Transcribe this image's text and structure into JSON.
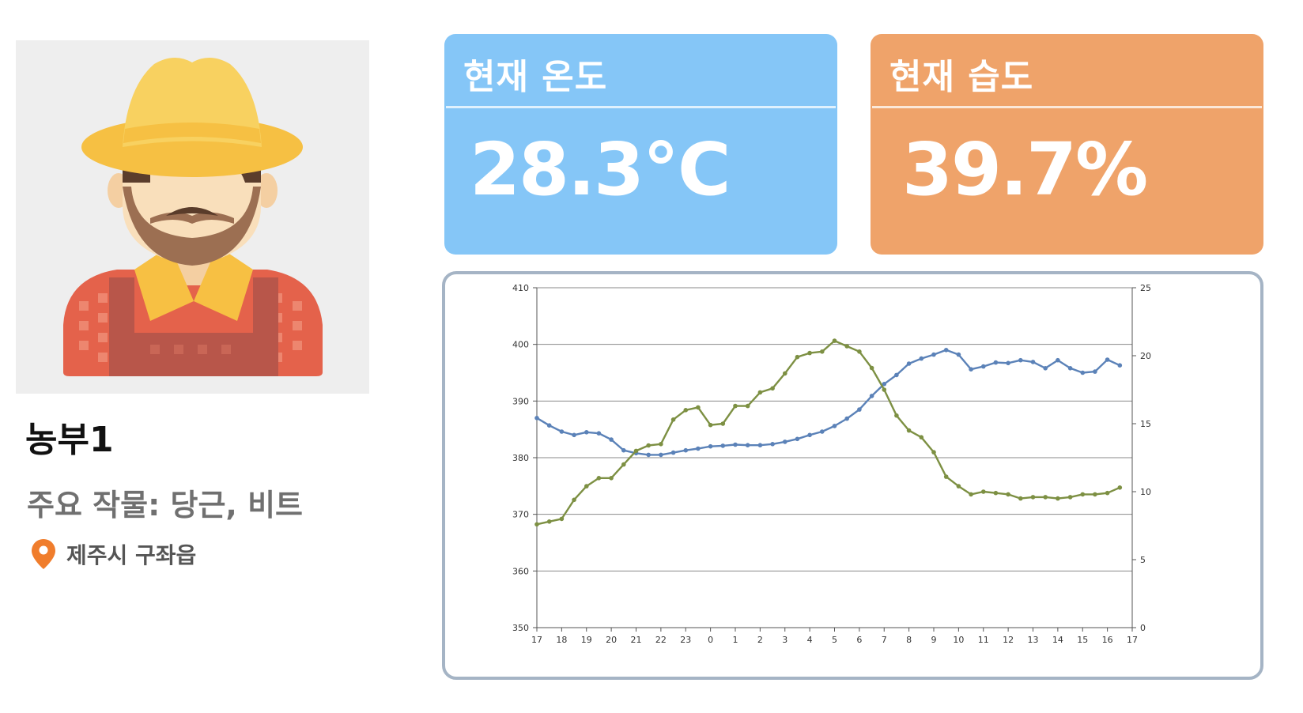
{
  "profile": {
    "name": "농부1",
    "crops": "주요 작물: 당근, 비트",
    "location": "제주시 구좌읍",
    "avatar_icon": "farmer-avatar",
    "location_icon": "map-pin-icon",
    "location_icon_color": "#f07d2c"
  },
  "cards": {
    "temperature": {
      "title": "현재 온도",
      "value": "28.3°C",
      "color": "#85c6f7"
    },
    "humidity": {
      "title": "현재 습도",
      "value": "39.7%",
      "color": "#efa36a"
    }
  },
  "chart_data": {
    "type": "line",
    "x_ticks": [
      "17",
      "18",
      "19",
      "20",
      "21",
      "22",
      "23",
      "0",
      "1",
      "2",
      "3",
      "4",
      "5",
      "6",
      "7",
      "8",
      "9",
      "10",
      "11",
      "12",
      "13",
      "14",
      "15",
      "16",
      "17"
    ],
    "y_left": {
      "ticks": [
        350,
        360,
        370,
        380,
        390,
        400,
        410
      ],
      "ylim": [
        350,
        410
      ]
    },
    "y_right": {
      "ticks": [
        0,
        5,
        10,
        15,
        20,
        25
      ],
      "ylim": [
        0,
        25
      ]
    },
    "grid": "horizontal",
    "series": [
      {
        "axis": "left",
        "color": "#5b82b8",
        "x": [
          0,
          0.5,
          1,
          1.5,
          2,
          2.5,
          3,
          3.5,
          4,
          4.5,
          5,
          5.5,
          6,
          6.5,
          7,
          7.5,
          8,
          8.5,
          9,
          9.5,
          10,
          10.5,
          11,
          11.5,
          12,
          12.5,
          13,
          13.5,
          14,
          14.5,
          15,
          15.5,
          16,
          16.5,
          17,
          17.5,
          18,
          18.5,
          19,
          19.5,
          20,
          20.5,
          21,
          21.5,
          22,
          22.5,
          23,
          23.5
        ],
        "values": [
          387.0,
          385.7,
          384.6,
          384.0,
          384.5,
          384.3,
          383.2,
          381.3,
          380.8,
          380.5,
          380.5,
          380.9,
          381.3,
          381.6,
          382.0,
          382.1,
          382.3,
          382.2,
          382.2,
          382.4,
          382.8,
          383.3,
          384.0,
          384.6,
          385.6,
          386.9,
          388.5,
          390.9,
          393.0,
          394.6,
          396.6,
          397.5,
          398.2,
          399.0,
          398.2,
          395.6,
          396.1,
          396.8,
          396.7,
          397.2,
          396.9,
          395.8,
          397.2,
          395.8,
          395.0,
          395.2,
          397.3,
          396.3
        ]
      },
      {
        "axis": "right",
        "color": "#7d9043",
        "x": [
          0,
          0.5,
          1,
          1.5,
          2,
          2.5,
          3,
          3.5,
          4,
          4.5,
          5,
          5.5,
          6,
          6.5,
          7,
          7.5,
          8,
          8.5,
          9,
          9.5,
          10,
          10.5,
          11,
          11.5,
          12,
          12.5,
          13,
          13.5,
          14,
          14.5,
          15,
          15.5,
          16,
          16.5,
          17,
          17.5,
          18,
          18.5,
          19,
          19.5,
          20,
          20.5,
          21,
          21.5,
          22,
          22.5,
          23,
          23.5
        ],
        "values": [
          7.6,
          7.8,
          8.0,
          9.4,
          10.4,
          11.0,
          11.0,
          12.0,
          13.0,
          13.4,
          13.5,
          15.3,
          16.0,
          16.2,
          14.9,
          15.0,
          16.3,
          16.3,
          17.3,
          17.6,
          18.7,
          19.9,
          20.2,
          20.3,
          21.1,
          20.7,
          20.3,
          19.1,
          17.5,
          15.6,
          14.5,
          14.0,
          12.9,
          11.1,
          10.4,
          9.8,
          10.0,
          9.9,
          9.8,
          9.5,
          9.6,
          9.6,
          9.5,
          9.6,
          9.8,
          9.8,
          9.9,
          10.3
        ]
      }
    ]
  }
}
